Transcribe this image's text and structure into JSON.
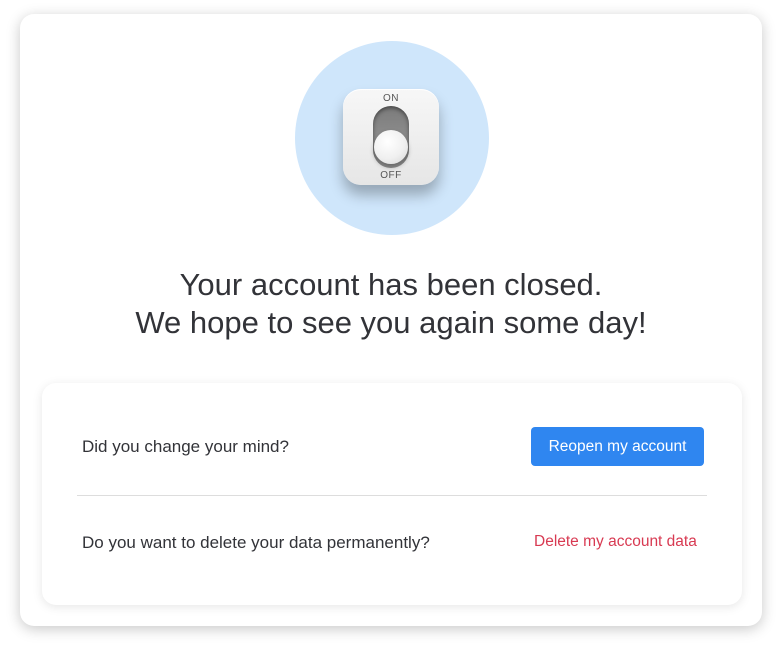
{
  "hero": {
    "icon": "toggle-switch-off-icon",
    "switch_on_label": "ON",
    "switch_off_label": "OFF",
    "circle_color": "#cfe6fb"
  },
  "message": {
    "line1": "Your account has been closed.",
    "line2": "We hope to see you again some day!"
  },
  "options": {
    "reopen_prompt": "Did you change your mind?",
    "reopen_button_label": "Reopen my account",
    "delete_prompt": "Do you want to delete your data permanently?",
    "delete_link_label": "Delete my account data"
  },
  "colors": {
    "primary_button": "#2f86f0",
    "danger_link": "#d83a52",
    "text": "#323338"
  }
}
